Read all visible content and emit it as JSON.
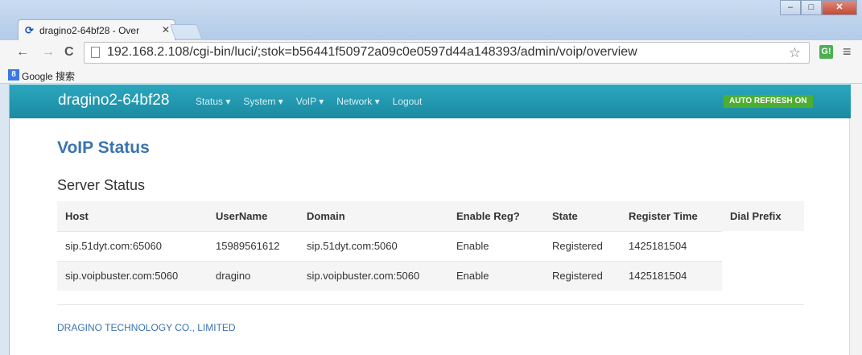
{
  "browser": {
    "tab_title": "dragino2-64bf28 - Over",
    "tab_icon": "luci-icon",
    "url": "192.168.2.108/cgi-bin/luci/;stok=b56441f50972a09c0e0597d44a148393/admin/voip/overview",
    "ext_label": "G!",
    "bookmarks": [
      {
        "label": "Google 搜索",
        "icon": "google-icon"
      }
    ]
  },
  "app": {
    "brand": "dragino2-64bf28",
    "nav": [
      "Status ▾",
      "System ▾",
      "VoIP ▾",
      "Network ▾",
      "Logout"
    ],
    "auto_refresh": "AUTO REFRESH ON"
  },
  "page": {
    "title": "VoIP Status",
    "section": "Server Status",
    "columns": [
      "Host",
      "UserName",
      "Domain",
      "Enable Reg?",
      "State",
      "Register Time",
      "Dial Prefix"
    ],
    "rows": [
      [
        "sip.51dyt.com:65060",
        "15989561612",
        "sip.51dyt.com:5060",
        "Enable",
        "Registered",
        "1425181504",
        ""
      ],
      [
        "sip.voipbuster.com:5060",
        "dragino",
        "sip.voipbuster.com:5060",
        "Enable",
        "Registered",
        "1425181504",
        ""
      ]
    ],
    "footer": "DRAGINO TECHNOLOGY CO., LIMITED"
  },
  "colors": {
    "navbar": "#1f96ad",
    "accent": "#3b73b0",
    "badge": "#4caf32"
  }
}
